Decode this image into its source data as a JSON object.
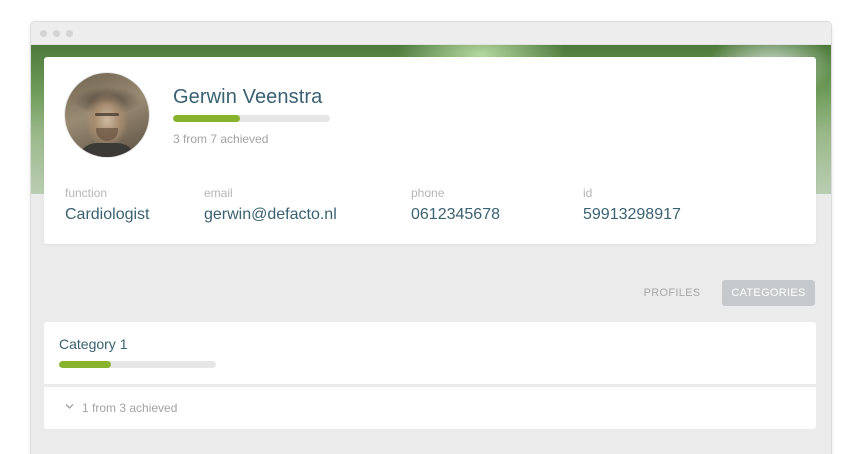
{
  "window": {
    "traffic_dots": [
      "dot",
      "dot",
      "dot"
    ]
  },
  "profile": {
    "name": "Gerwin Veenstra",
    "progress": {
      "achieved": 3,
      "total": 7,
      "fraction": 0.4286
    },
    "achieved_text": "3 from 7 achieved",
    "fields": {
      "function": {
        "label": "function",
        "value": "Cardiologist"
      },
      "email": {
        "label": "email",
        "value": "gerwin@defacto.nl"
      },
      "phone": {
        "label": "phone",
        "value": "0612345678"
      },
      "id": {
        "label": "id",
        "value": "59913298917"
      }
    }
  },
  "tabs": {
    "profiles": "PROFILES",
    "categories": "CATEGORIES",
    "active": "categories"
  },
  "category": {
    "title": "Category 1",
    "progress": {
      "achieved": 1,
      "total": 3,
      "fraction": 0.3333
    },
    "achieved_text": "1 from 3 achieved",
    "expand_icon": "chevron-down-icon"
  },
  "colors": {
    "accent_green": "#88b32e",
    "text_blue": "#3a6171",
    "muted": "#a3a3a3",
    "active_tab_bg": "#c5c9cb"
  }
}
